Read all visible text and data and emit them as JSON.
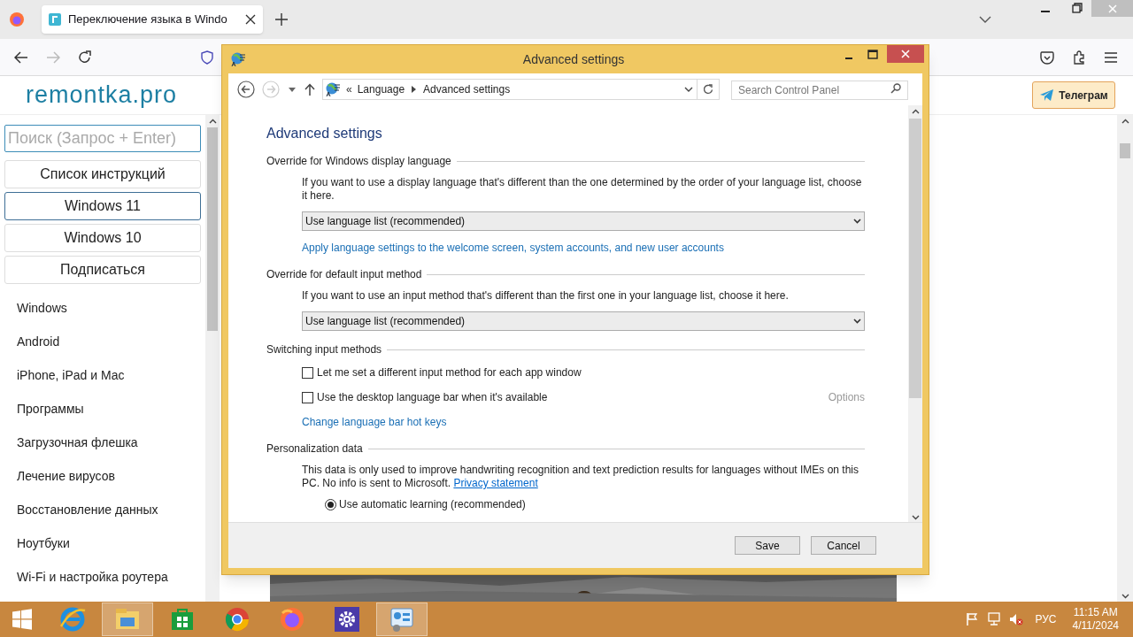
{
  "browser": {
    "tabs": [
      {
        "title": "Переключение языка в Windo",
        "selected": true
      }
    ]
  },
  "page": {
    "logo": "remontka.pro",
    "telegram_button": "Телеграм",
    "search": {
      "placeholder": "Поиск (Запрос + Enter)"
    },
    "nav_buttons": [
      {
        "label": "Список инструкций",
        "selected": false
      },
      {
        "label": "Windows 11",
        "selected": true
      },
      {
        "label": "Windows 10",
        "selected": false
      },
      {
        "label": "Подписаться",
        "selected": false
      }
    ],
    "categories": [
      "Windows",
      "Android",
      "iPhone, iPad и Mac",
      "Программы",
      "Загрузочная флешка",
      "Лечение вирусов",
      "Восстановление данных",
      "Ноутбуки",
      "Wi-Fi и настройка роутера"
    ]
  },
  "dialog": {
    "title": "Advanced settings",
    "breadcrumb_prefix": "«",
    "breadcrumb": [
      "Language",
      "Advanced settings"
    ],
    "search": {
      "placeholder": "Search Control Panel"
    },
    "heading": "Advanced settings",
    "sections": [
      {
        "title": "Override for Windows display language",
        "items": [
          {
            "kind": "text",
            "text": "If you want to use a display language that's different than the one determined by the order of your language list, choose it here."
          },
          {
            "kind": "select",
            "value": "Use language list (recommended)"
          },
          {
            "kind": "link",
            "text": "Apply language settings to the welcome screen, system accounts, and new user accounts"
          }
        ]
      },
      {
        "title": "Override for default input method",
        "items": [
          {
            "kind": "text",
            "text": "If you want to use an input method that's different than the first one in your language list, choose it here."
          },
          {
            "kind": "select",
            "value": "Use language list (recommended)"
          }
        ]
      },
      {
        "title": "Switching input methods",
        "items": [
          {
            "kind": "checkbox",
            "label": "Let me set a different input method for each app window",
            "checked": false
          },
          {
            "kind": "checkbox",
            "label": "Use the desktop language bar when it's available",
            "checked": false,
            "option": {
              "label": "Options",
              "disabled": true
            }
          },
          {
            "kind": "link",
            "text": "Change language bar hot keys"
          }
        ]
      },
      {
        "title": "Personalization data",
        "items": [
          {
            "kind": "text",
            "text": "This data is only used to improve handwriting recognition and text prediction results for languages without IMEs on this PC. No info is sent to Microsoft.",
            "link": "Privacy statement"
          },
          {
            "kind": "radio",
            "label": "Use automatic learning (recommended)",
            "selected": true
          }
        ]
      }
    ],
    "buttons": [
      "Save",
      "Cancel"
    ]
  },
  "taskbar": {
    "apps": [
      {
        "kind": "ie",
        "selected": false
      },
      {
        "kind": "explorer",
        "selected": true
      },
      {
        "kind": "store",
        "selected": false
      },
      {
        "kind": "chrome",
        "selected": false
      },
      {
        "kind": "firefox",
        "selected": false
      },
      {
        "kind": "settings",
        "selected": false
      },
      {
        "kind": "control-panel",
        "selected": true
      }
    ],
    "language": "РУС",
    "time": "11:15 AM",
    "date": "4/11/2024"
  }
}
